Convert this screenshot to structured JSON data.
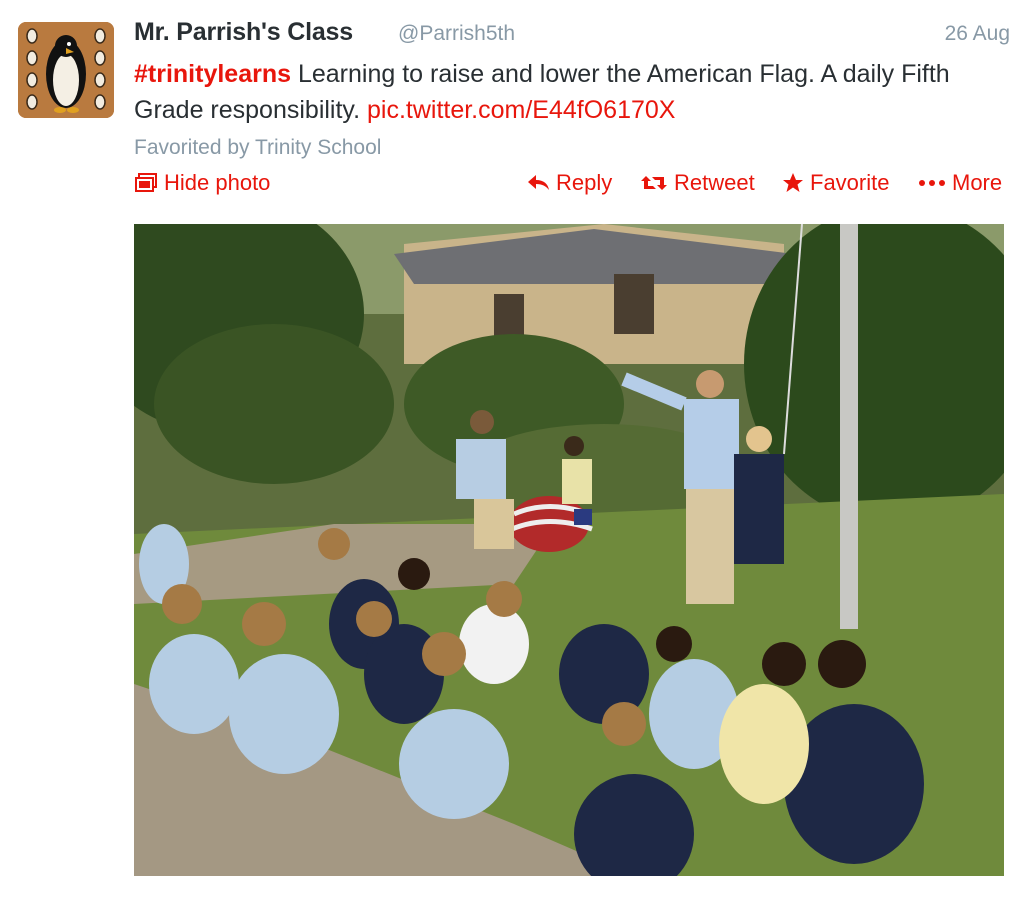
{
  "tweet": {
    "name": "Mr. Parrish's Class",
    "handle": "@Parrish5th",
    "time": "26 Aug",
    "hashtag": "#trinitylearns",
    "text": " Learning to raise and lower the American Flag. A daily Fifth Grade responsibility. ",
    "link": "pic.twitter.com/E44fO6170X",
    "favorited_by": "Favorited by Trinity School"
  },
  "actions": {
    "hide_photo": "Hide photo",
    "reply": "Reply",
    "retweet": "Retweet",
    "favorite": "Favorite",
    "more": "More"
  },
  "colors": {
    "accent": "#e8160c",
    "muted": "#8899a6",
    "text": "#292f33"
  },
  "icons": [
    "photo-icon",
    "reply-icon",
    "retweet-icon",
    "star-icon",
    "more-icon",
    "penguin-logo-icon"
  ]
}
